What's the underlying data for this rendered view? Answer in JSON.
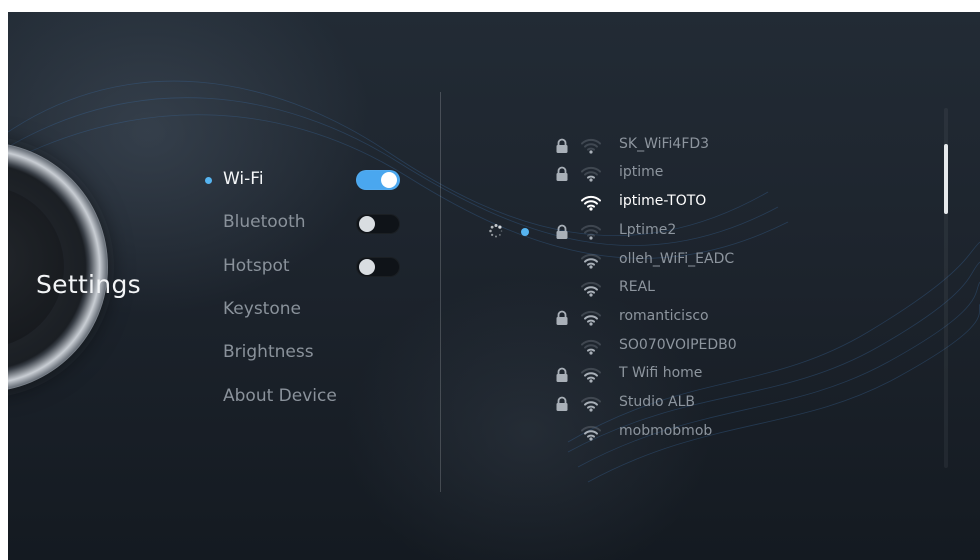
{
  "page": {
    "title": "Settings"
  },
  "menu": {
    "items": [
      {
        "label": "Wi-Fi",
        "active": true,
        "toggle": "on"
      },
      {
        "label": "Bluetooth",
        "active": false,
        "toggle": "off"
      },
      {
        "label": "Hotspot",
        "active": false,
        "toggle": "off"
      },
      {
        "label": "Keystone",
        "active": false
      },
      {
        "label": "Brightness",
        "active": false
      },
      {
        "label": "About Device",
        "active": false
      }
    ]
  },
  "wifi": {
    "networks": [
      {
        "name": "SK_WiFi4FD3",
        "secured": true,
        "signal": 1
      },
      {
        "name": "iptime",
        "secured": true,
        "signal": 2
      },
      {
        "name": "iptime-TOTO",
        "secured": false,
        "signal": 4,
        "current": true
      },
      {
        "name": "Lptime2",
        "secured": true,
        "signal": 1,
        "connecting": true
      },
      {
        "name": "olleh_WiFi_EADC",
        "secured": false,
        "signal": 3
      },
      {
        "name": "REAL",
        "secured": false,
        "signal": 3
      },
      {
        "name": "romanticisco",
        "secured": true,
        "signal": 3
      },
      {
        "name": "SO070VOIPEDB0",
        "secured": false,
        "signal": 2
      },
      {
        "name": "T Wifi home",
        "secured": true,
        "signal": 3
      },
      {
        "name": "Studio ALB",
        "secured": true,
        "signal": 3
      },
      {
        "name": "mobmobmob",
        "secured": false,
        "signal": 3
      }
    ]
  },
  "colors": {
    "accent": "#4aa7ef",
    "indicator_dot": "#56b4f0",
    "text_primary": "#f4f6f8",
    "text_secondary": "#8a929b"
  },
  "icons": {
    "lock": "lock-icon",
    "wifi": "wifi-signal-icon",
    "spinner": "loading-spinner-icon"
  }
}
